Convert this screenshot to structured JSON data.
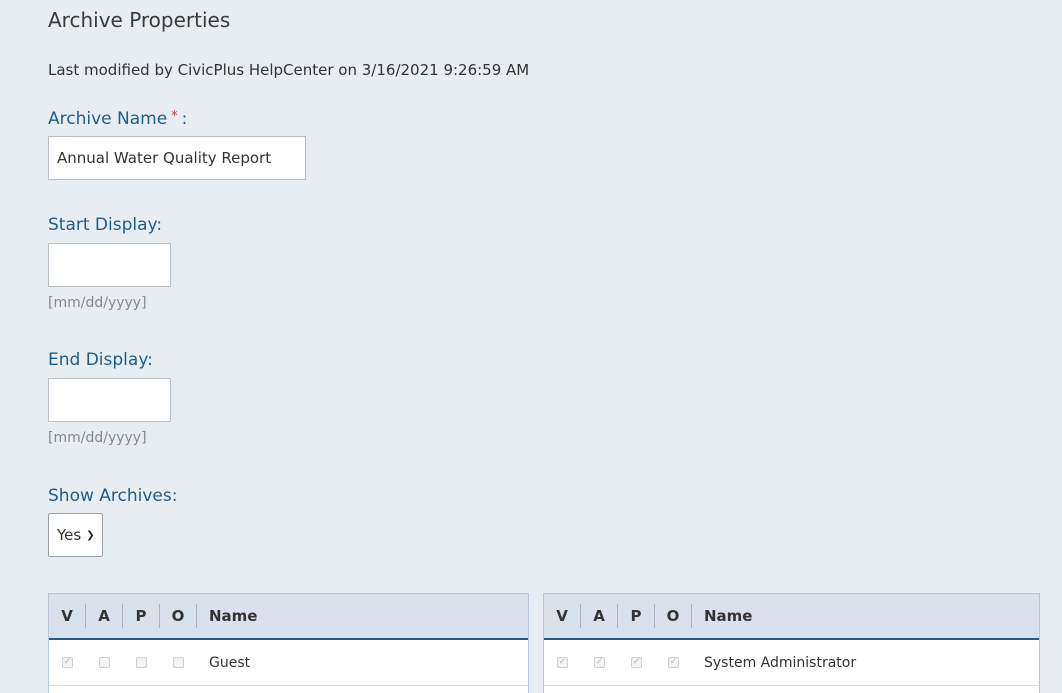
{
  "title": "Archive Properties",
  "modified_text": "Last modified by CivicPlus HelpCenter on 3/16/2021 9:26:59 AM",
  "archive_name": {
    "label": "Archive Name",
    "required_mark": "*",
    "suffix": ":",
    "value": "Annual Water Quality Report"
  },
  "start_display": {
    "label": "Start Display:",
    "value": "",
    "hint": "[mm/dd/yyyy]"
  },
  "end_display": {
    "label": "End Display:",
    "value": "",
    "hint": "[mm/dd/yyyy]"
  },
  "show_archives": {
    "label": "Show Archives:",
    "selected": "Yes"
  },
  "permission_columns": [
    "V",
    "A",
    "P",
    "O",
    "Name"
  ],
  "left_grid": {
    "rows": [
      {
        "name": "Guest",
        "v": true,
        "a": false,
        "p": false,
        "o": false
      }
    ]
  },
  "right_grid": {
    "rows": [
      {
        "name": "System Administrator",
        "v": true,
        "a": true,
        "p": true,
        "o": true
      }
    ]
  },
  "colors": {
    "background": "#e8edf2",
    "label": "#1d5d8a",
    "required": "#d13b3b",
    "grid_header": "#d9e2ec"
  }
}
